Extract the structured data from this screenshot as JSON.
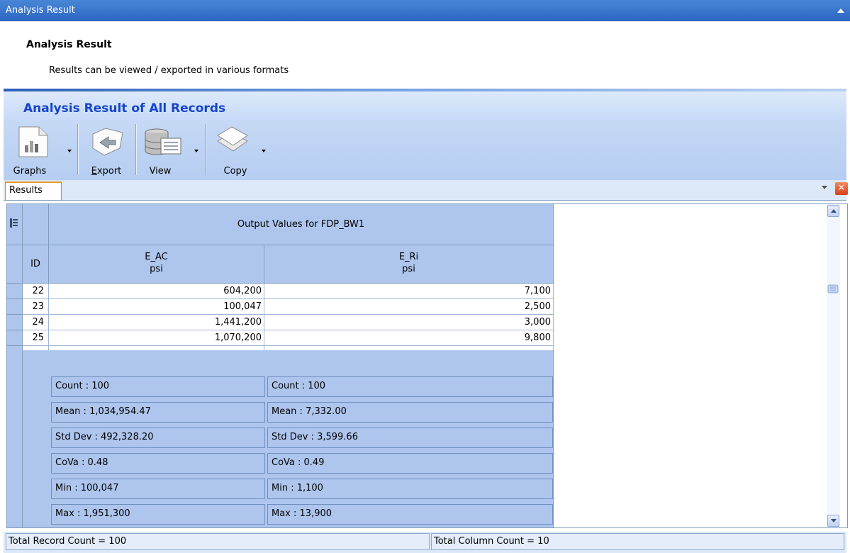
{
  "window": {
    "title": "Analysis Result"
  },
  "header": {
    "title": "Analysis Result",
    "subtitle": "Results can be viewed / exported in various formats"
  },
  "section": {
    "title": "Analysis Result of All Records"
  },
  "toolbar": {
    "graphs": "Graphs",
    "export_prefix": "",
    "export_mnemonic": "E",
    "export_rest": "xport",
    "view": "View",
    "copy": "Copy"
  },
  "tabs": [
    {
      "label": "Results",
      "active": true
    }
  ],
  "grid": {
    "band_header": "Output Values for FDP_BW1",
    "columns": [
      {
        "key": "id",
        "label": "ID"
      },
      {
        "key": "e_ac",
        "label": "E_AC",
        "unit": "psi"
      },
      {
        "key": "e_ri",
        "label": "E_Ri",
        "unit": "psi"
      }
    ],
    "rows": [
      {
        "id": "22",
        "e_ac": "604,200",
        "e_ri": "7,100"
      },
      {
        "id": "23",
        "e_ac": "100,047",
        "e_ri": "2,500"
      },
      {
        "id": "24",
        "e_ac": "1,441,200",
        "e_ri": "3,000"
      },
      {
        "id": "25",
        "e_ac": "1,070,200",
        "e_ri": "9,800"
      }
    ],
    "summary": {
      "e_ac": [
        "Count : 100",
        "Mean : 1,034,954.47",
        "Std Dev : 492,328.20",
        "CoVa : 0.48",
        "Min : 100,047",
        "Max : 1,951,300"
      ],
      "e_ri": [
        "Count : 100",
        "Mean : 7,332.00",
        "Std Dev : 3,599.66",
        "CoVa : 0.49",
        "Min : 1,100",
        "Max : 13,900"
      ]
    }
  },
  "status": {
    "records": "Total Record Count = 100",
    "columns": "Total Column Count = 10"
  },
  "colors": {
    "title_bar": "#2a66c4",
    "section_title": "#1646c8",
    "header_fill": "#aec6ee",
    "tab_accent": "#e69a2e"
  }
}
